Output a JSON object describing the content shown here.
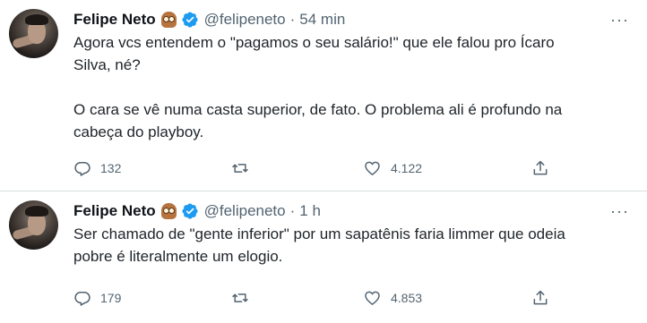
{
  "tweets": [
    {
      "author_name": "Felipe Neto",
      "badge_icon": "owl-emoji",
      "verified_icon": "verified-badge-icon",
      "handle": "@felipeneto",
      "separator": "·",
      "time": "54 min",
      "more_label": "···",
      "paragraphs": [
        "Agora vcs entendem o \"pagamos o seu salário!\" que ele falou pro Ícaro\nSilva, né?",
        "O cara se vê numa casta superior, de fato. O problema ali é profundo na\ncabeça do playboy."
      ],
      "actions": {
        "replies": "132",
        "retweets": "",
        "likes": "4.122",
        "share_icon": "share-icon"
      }
    },
    {
      "author_name": "Felipe Neto",
      "badge_icon": "owl-emoji",
      "verified_icon": "verified-badge-icon",
      "handle": "@felipeneto",
      "separator": "·",
      "time": "1 h",
      "more_label": "···",
      "paragraphs": [
        "Ser chamado de \"gente inferior\" por um sapatênis faria limmer que odeia\npobre é literalmente um elogio."
      ],
      "actions": {
        "replies": "179",
        "retweets": "",
        "likes": "4.853",
        "share_icon": "share-icon"
      }
    }
  ],
  "colors": {
    "text": "#0f1419",
    "secondary": "#536471",
    "verified": "#1d9bf0",
    "divider": "#d8dde0"
  }
}
